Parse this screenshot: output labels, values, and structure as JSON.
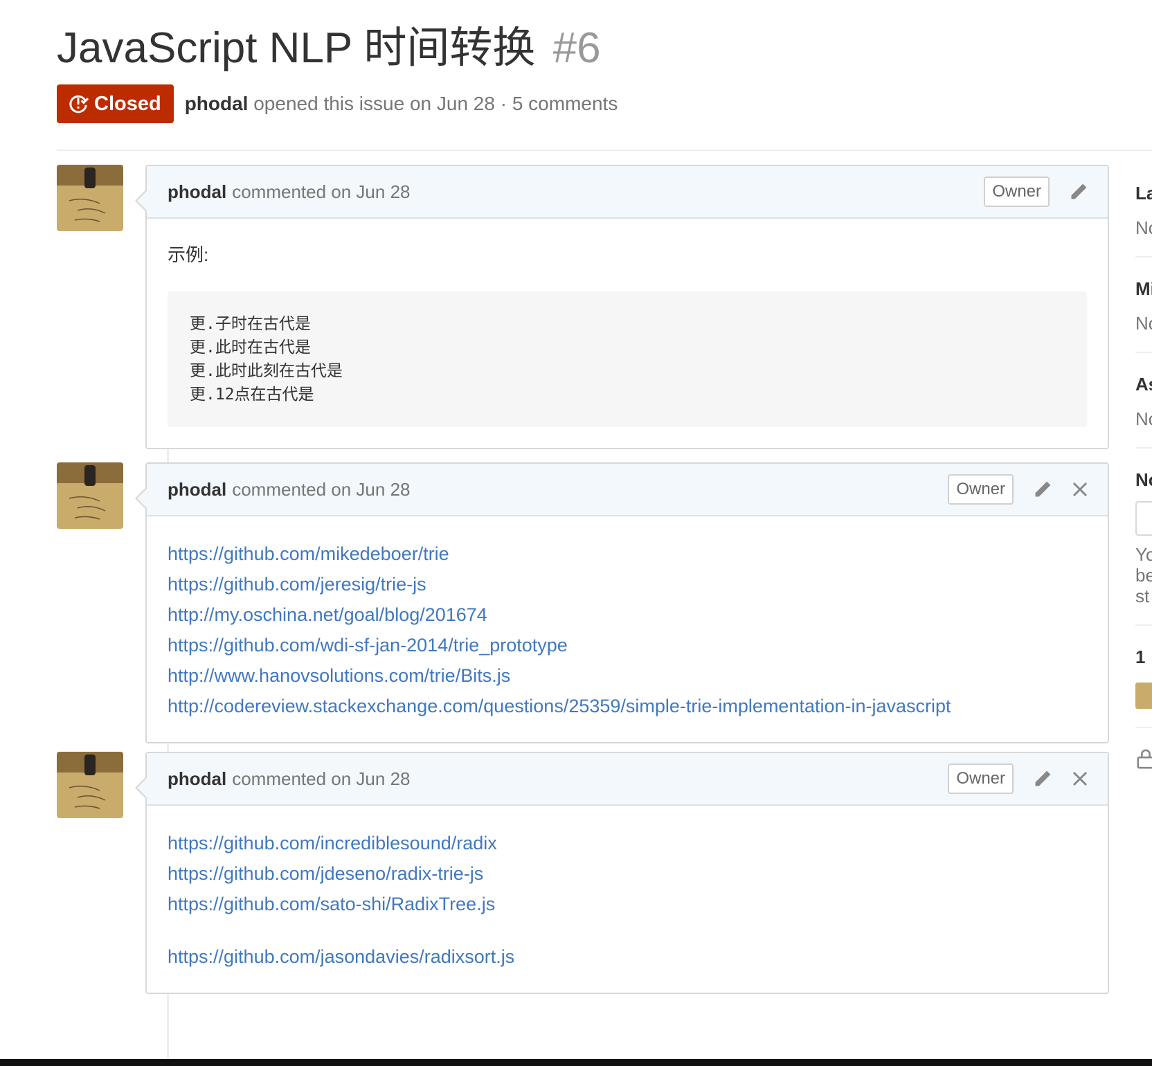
{
  "issue": {
    "title": "JavaScript NLP 时间转换",
    "number": "#6",
    "state": "Closed",
    "author": "phodal",
    "opened_text": "opened this issue on Jun 28 · 5 comments"
  },
  "comments": [
    {
      "author": "phodal",
      "date_text": "commented on Jun 28",
      "role": "Owner",
      "intro": "示例:",
      "code_lines": [
        "更.子时在古代是",
        "更.此时在古代是",
        "更.此时此刻在古代是",
        "更.12点在古代是"
      ]
    },
    {
      "author": "phodal",
      "date_text": "commented on Jun 28",
      "role": "Owner",
      "links": [
        "https://github.com/mikedeboer/trie",
        "https://github.com/jeresig/trie-js",
        "http://my.oschina.net/goal/blog/201674",
        "https://github.com/wdi-sf-jan-2014/trie_prototype",
        "http://www.hanovsolutions.com/trie/Bits.js",
        "http://codereview.stackexchange.com/questions/25359/simple-trie-implementation-in-javascript"
      ]
    },
    {
      "author": "phodal",
      "date_text": "commented on Jun 28",
      "role": "Owner",
      "links": [
        "https://github.com/incrediblesound/radix",
        "https://github.com/jdeseno/radix-trie-js",
        "https://github.com/sato-shi/RadixTree.js",
        "https://github.com/jasondavies/radixsort.js"
      ]
    }
  ],
  "sidebar": {
    "labels_heading": "La",
    "labels_value": "No",
    "milestone_heading": "Mi",
    "milestone_value": "No",
    "assignee_heading": "As",
    "assignee_value": "No",
    "notifications_heading": "No",
    "notif_text_1": "Yo",
    "notif_text_2": "be",
    "notif_text_3": "st",
    "participants_heading": "1"
  },
  "colors": {
    "closed": "#bd2c00",
    "link": "#4078c0",
    "header_bg": "#f3f8fc"
  }
}
